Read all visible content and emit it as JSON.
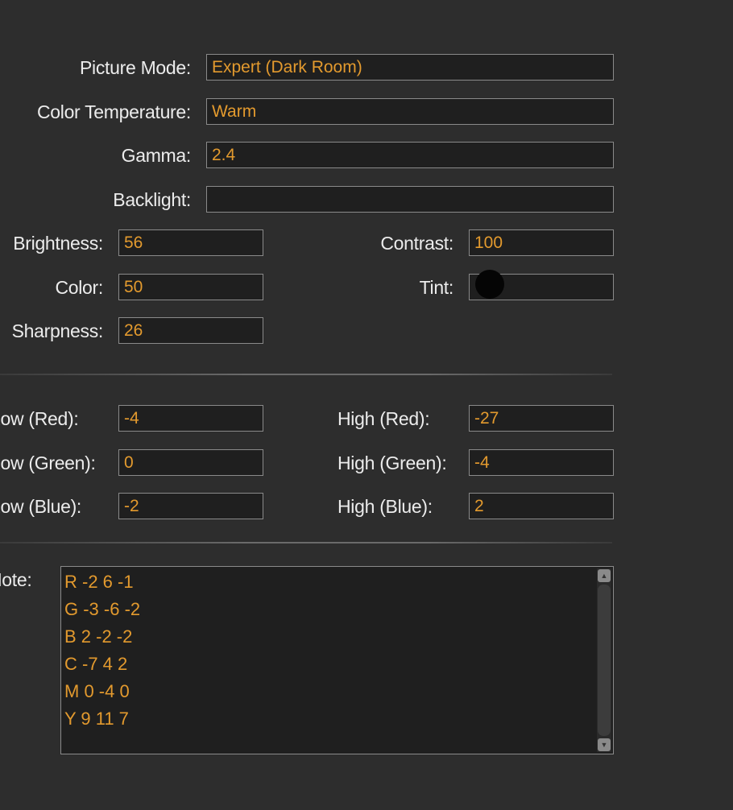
{
  "picture": {
    "picture_mode": {
      "label": "Picture Mode:",
      "value": "Expert (Dark Room)"
    },
    "color_temperature": {
      "label": "Color Temperature:",
      "value": "Warm"
    },
    "gamma": {
      "label": "Gamma:",
      "value": "2.4"
    },
    "backlight": {
      "label": "Backlight:",
      "value": ""
    },
    "brightness": {
      "label": "Brightness:",
      "value": "56"
    },
    "contrast": {
      "label": "Contrast:",
      "value": "100"
    },
    "color": {
      "label": "Color:",
      "value": "50"
    },
    "tint": {
      "label": "Tint:",
      "value": ""
    },
    "sharpness": {
      "label": "Sharpness:",
      "value": "26"
    }
  },
  "white_balance": {
    "low_red": {
      "label": "Low (Red):",
      "value": "-4"
    },
    "high_red": {
      "label": "High (Red):",
      "value": "-27"
    },
    "low_green": {
      "label": "Low (Green):",
      "value": "0"
    },
    "high_green": {
      "label": "High (Green):",
      "value": "-4"
    },
    "low_blue": {
      "label": "Low (Blue):",
      "value": "-2"
    },
    "high_blue": {
      "label": "High (Blue):",
      "value": "2"
    }
  },
  "note": {
    "label": "Note:",
    "lines": [
      "R -2 6 -1",
      "G -3 -6 -2",
      "B 2 -2 -2",
      "C -7 4 2",
      "M 0 -4 0",
      "Y 9 11 7"
    ]
  },
  "colors": {
    "background": "#2d2d2d",
    "field": "#1f1f1f",
    "value_text": "#e39a2e",
    "label_text": "#ececec"
  }
}
